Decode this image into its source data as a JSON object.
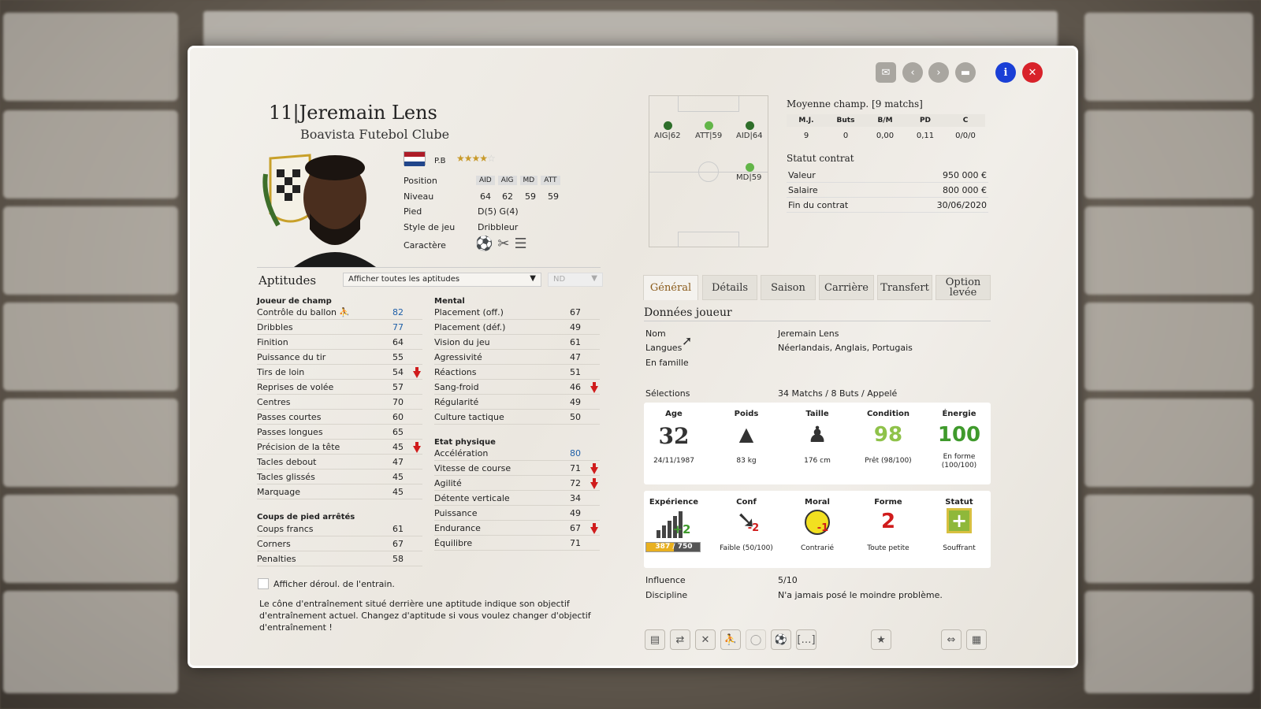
{
  "player": {
    "number_name": "11|Jeremain Lens",
    "club": "Boavista Futebol Clube",
    "country_code": "P.B",
    "stars": 3.5,
    "position_label": "Position",
    "positions": [
      "AID",
      "AIG",
      "MD",
      "ATT"
    ],
    "level_label": "Niveau",
    "levels": [
      "64",
      "62",
      "59",
      "59"
    ],
    "foot_label": "Pied",
    "foot": "D(5) G(4)",
    "style_label": "Style de jeu",
    "style": "Dribbleur",
    "character_label": "Caractère"
  },
  "aptitudes": {
    "title": "Aptitudes",
    "filter": "Afficher toutes les aptitudes",
    "nd": "ND",
    "field_header": "Joueur de champ",
    "field": [
      {
        "name": "Contrôle du ballon",
        "value": "82"
      },
      {
        "name": "Dribbles",
        "value": "77"
      },
      {
        "name": "Finition",
        "value": "64"
      },
      {
        "name": "Puissance du tir",
        "value": "55"
      },
      {
        "name": "Tirs de loin",
        "value": "54"
      },
      {
        "name": "Reprises de volée",
        "value": "57"
      },
      {
        "name": "Centres",
        "value": "70"
      },
      {
        "name": "Passes courtes",
        "value": "60"
      },
      {
        "name": "Passes longues",
        "value": "65"
      },
      {
        "name": "Précision de la tête",
        "value": "45"
      },
      {
        "name": "Tacles debout",
        "value": "47"
      },
      {
        "name": "Tacles glissés",
        "value": "45"
      },
      {
        "name": "Marquage",
        "value": "45"
      }
    ],
    "setpiece_header": "Coups de pied arrêtés",
    "setpiece": [
      {
        "name": "Coups francs",
        "value": "61"
      },
      {
        "name": "Corners",
        "value": "67"
      },
      {
        "name": "Penalties",
        "value": "58"
      }
    ],
    "mental_header": "Mental",
    "mental": [
      {
        "name": "Placement (off.)",
        "value": "67"
      },
      {
        "name": "Placement (déf.)",
        "value": "49"
      },
      {
        "name": "Vision du jeu",
        "value": "61"
      },
      {
        "name": "Agressivité",
        "value": "47"
      },
      {
        "name": "Réactions",
        "value": "51"
      },
      {
        "name": "Sang-froid",
        "value": "46"
      },
      {
        "name": "Régularité",
        "value": "49"
      },
      {
        "name": "Culture tactique",
        "value": "50"
      }
    ],
    "physical_header": "Etat physique",
    "physical": [
      {
        "name": "Accélération",
        "value": "80"
      },
      {
        "name": "Vitesse de course",
        "value": "71"
      },
      {
        "name": "Agilité",
        "value": "72"
      },
      {
        "name": "Détente verticale",
        "value": "34"
      },
      {
        "name": "Puissance",
        "value": "49"
      },
      {
        "name": "Endurance",
        "value": "67"
      },
      {
        "name": "Équilibre",
        "value": "71"
      }
    ],
    "checkbox_label": "Afficher déroul. de l'entrain.",
    "hint": "Le cône d'entraînement situé derrière une aptitude indique son objectif d'entraînement actuel. Changez d'aptitude si vous voulez changer d'objectif d'entraînement !"
  },
  "pitch_positions": [
    {
      "label": "AIG|62"
    },
    {
      "label": "ATT|59"
    },
    {
      "label": "AID|64"
    },
    {
      "label": "MD|59"
    }
  ],
  "league_avg": {
    "title": "Moyenne champ. [9 matchs]",
    "headers": [
      "M.J.",
      "Buts",
      "B/M",
      "PD",
      "C"
    ],
    "values": [
      "9",
      "0",
      "0,00",
      "0,11",
      "0/0/0"
    ]
  },
  "contract": {
    "title": "Statut contrat",
    "rows": [
      {
        "label": "Valeur",
        "value": "950 000 €"
      },
      {
        "label": "Salaire",
        "value": "800 000 €"
      },
      {
        "label": "Fin du contrat",
        "value": "30/06/2020"
      }
    ]
  },
  "tabs": [
    "Général",
    "Détails",
    "Saison",
    "Carrière",
    "Transfert",
    "Option levée"
  ],
  "player_data": {
    "title": "Données joueur",
    "name_label": "Nom",
    "name": "Jeremain Lens",
    "languages_label": "Langues",
    "languages": "Néerlandais, Anglais, Portugais",
    "family_label": "En famille",
    "caps_label": "Sélections",
    "caps": "34 Matchs / 8 Buts / Appelé"
  },
  "card1": {
    "age_h": "Age",
    "age": "32",
    "dob": "24/11/1987",
    "weight_h": "Poids",
    "weight": "83 kg",
    "height_h": "Taille",
    "height": "176 cm",
    "cond_h": "Condition",
    "cond": "98",
    "cond_sub": "Prêt (98/100)",
    "energy_h": "Énergie",
    "energy": "100",
    "energy_sub": "En forme (100/100)"
  },
  "card2": {
    "exp_h": "Expérience",
    "exp_delta": "+2",
    "exp_bar": "387 / 750",
    "exp_fill": 0.516,
    "conf_h": "Conf",
    "conf_delta": "-2",
    "conf_sub": "Faible (50/100)",
    "moral_h": "Moral",
    "moral_delta": "-1",
    "moral_sub": "Contrarié",
    "form_h": "Forme",
    "form": "2",
    "form_sub": "Toute petite",
    "status_h": "Statut",
    "status_sub": "Souffrant"
  },
  "influence_label": "Influence",
  "influence": "5/10",
  "discipline_label": "Discipline",
  "discipline": "N'a jamais posé le moindre problème.",
  "colors": {
    "accent": "#8a5a1a",
    "green": "#3f9a2c",
    "red": "#d01c1c",
    "blue": "#1a3fd6",
    "link": "#1f5fa8"
  }
}
